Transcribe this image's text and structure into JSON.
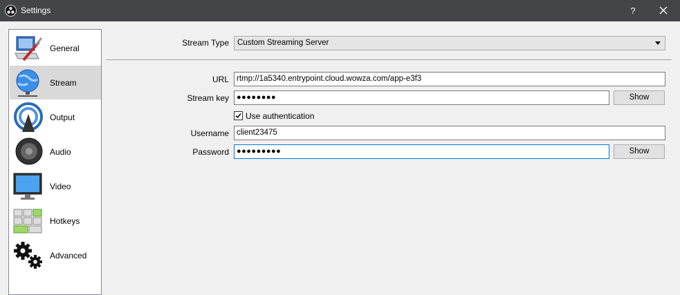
{
  "window": {
    "title": "Settings",
    "help_label": "?"
  },
  "sidebar": {
    "items": [
      {
        "label": "General",
        "icon": "general-icon"
      },
      {
        "label": "Stream",
        "icon": "stream-icon",
        "selected": true
      },
      {
        "label": "Output",
        "icon": "output-icon"
      },
      {
        "label": "Audio",
        "icon": "audio-icon"
      },
      {
        "label": "Video",
        "icon": "video-icon"
      },
      {
        "label": "Hotkeys",
        "icon": "hotkeys-icon"
      },
      {
        "label": "Advanced",
        "icon": "advanced-icon"
      }
    ]
  },
  "stream": {
    "stream_type_label": "Stream Type",
    "stream_type_value": "Custom Streaming Server",
    "url_label": "URL",
    "url_value": "rtmp://1a5340.entrypoint.cloud.wowza.com/app-e3f3",
    "key_label": "Stream key",
    "key_value": "●●●●●●●●",
    "key_show": "Show",
    "auth_label": "Use authentication",
    "auth_checked": true,
    "username_label": "Username",
    "username_value": "client23475",
    "password_label": "Password",
    "password_value": "●●●●●●●●●",
    "password_show": "Show"
  },
  "colors": {
    "titlebar": "#444546",
    "selected_item": "#d9d9d9",
    "focus_border": "#0078d7"
  }
}
